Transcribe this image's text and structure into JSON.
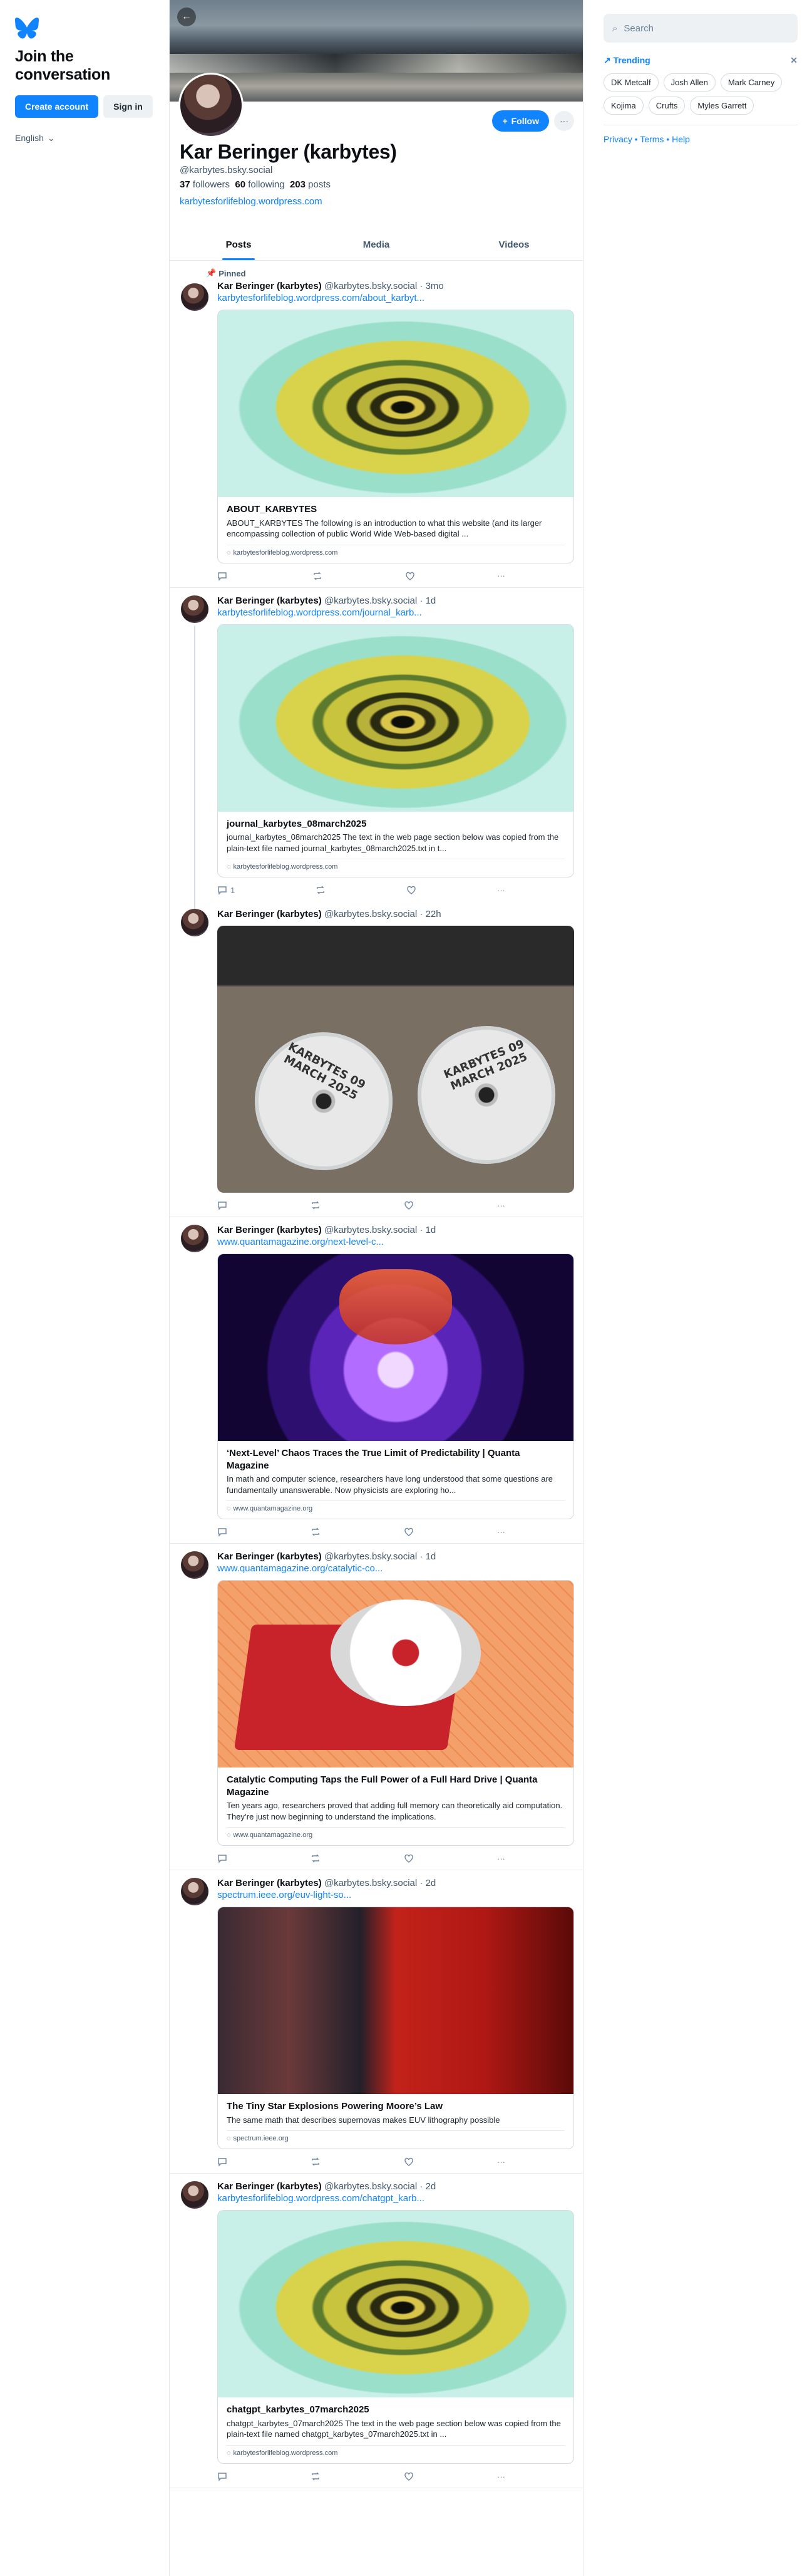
{
  "sidebar": {
    "join_title": "Join the conversation",
    "create_account": "Create account",
    "sign_in": "Sign in",
    "language": "English"
  },
  "profile": {
    "display_name": "Kar Beringer (karbytes)",
    "handle": "@karbytes.bsky.social",
    "followers_count": "37",
    "followers_label": "followers",
    "following_count": "60",
    "following_label": "following",
    "posts_count": "203",
    "posts_label": "posts",
    "website": "karbytesforlifeblog.wordpress.com",
    "follow_label": "Follow"
  },
  "tabs": [
    "Posts",
    "Media",
    "Videos"
  ],
  "pinned_label": "Pinned",
  "posts": [
    {
      "name": "Kar Beringer (karbytes)",
      "handle": "@karbytes.bsky.social",
      "time": "· 3mo",
      "link": "karbytesforlifeblog.wordpress.com/about_karbyt...",
      "card_title": "ABOUT_KARBYTES",
      "card_desc": "ABOUT_KARBYTES The following is an introduction to what this website (and its larger encompassing collection of public World Wide Web-based digital ...",
      "card_domain": "karbytesforlifeblog.wordpress.com",
      "replies": ""
    },
    {
      "name": "Kar Beringer (karbytes)",
      "handle": "@karbytes.bsky.social",
      "time": "· 1d",
      "link": "karbytesforlifeblog.wordpress.com/journal_karb...",
      "card_title": "journal_karbytes_08march2025",
      "card_desc": "journal_karbytes_08march2025 The text in the web page section below was copied from the plain-text file named journal_karbytes_08march2025.txt in t...",
      "card_domain": "karbytesforlifeblog.wordpress.com",
      "replies": "1"
    },
    {
      "name": "Kar Beringer (karbytes)",
      "handle": "@karbytes.bsky.social",
      "time": "· 22h",
      "disc_left": "KARBYTES 09 MARCH 2025",
      "disc_right": "KARBYTES 09 MARCH 2025",
      "replies": ""
    },
    {
      "name": "Kar Beringer (karbytes)",
      "handle": "@karbytes.bsky.social",
      "time": "· 1d",
      "link": "www.quantamagazine.org/next-level-c...",
      "card_title": "‘Next-Level’ Chaos Traces the True Limit of Predictability | Quanta Magazine",
      "card_desc": "In math and computer science, researchers have long understood that some questions are fundamentally unanswerable. Now physicists are exploring ho...",
      "card_domain": "www.quantamagazine.org",
      "replies": ""
    },
    {
      "name": "Kar Beringer (karbytes)",
      "handle": "@karbytes.bsky.social",
      "time": "· 1d",
      "link": "www.quantamagazine.org/catalytic-co...",
      "card_title": "Catalytic Computing Taps the Full Power of a Full Hard Drive | Quanta Magazine",
      "card_desc": "Ten years ago, researchers proved that adding full memory can theoretically aid computation. They’re just now beginning to understand the implications.",
      "card_domain": "www.quantamagazine.org",
      "replies": ""
    },
    {
      "name": "Kar Beringer (karbytes)",
      "handle": "@karbytes.bsky.social",
      "time": "· 2d",
      "link": "spectrum.ieee.org/euv-light-so...",
      "card_title": "The Tiny Star Explosions Powering Moore’s Law",
      "card_desc": "The same math that describes supernovas makes EUV lithography possible",
      "card_domain": "spectrum.ieee.org",
      "replies": ""
    },
    {
      "name": "Kar Beringer (karbytes)",
      "handle": "@karbytes.bsky.social",
      "time": "· 2d",
      "link": "karbytesforlifeblog.wordpress.com/chatgpt_karb...",
      "card_title": "chatgpt_karbytes_07march2025",
      "card_desc": "chatgpt_karbytes_07march2025 The text in the web page section below was copied from the plain-text file named chatgpt_karbytes_07march2025.txt in ...",
      "card_domain": "karbytesforlifeblog.wordpress.com",
      "replies": ""
    }
  ],
  "right": {
    "search_placeholder": "Search",
    "trending_label": "Trending",
    "trending": [
      "DK Metcalf",
      "Josh Allen",
      "Mark Carney",
      "Kojima",
      "Crufts",
      "Myles Garrett"
    ],
    "footer": "Privacy • Terms • Help"
  },
  "colors": {
    "accent": "#1083fe",
    "muted_text": "#42576c",
    "border": "#e4e9ee"
  }
}
